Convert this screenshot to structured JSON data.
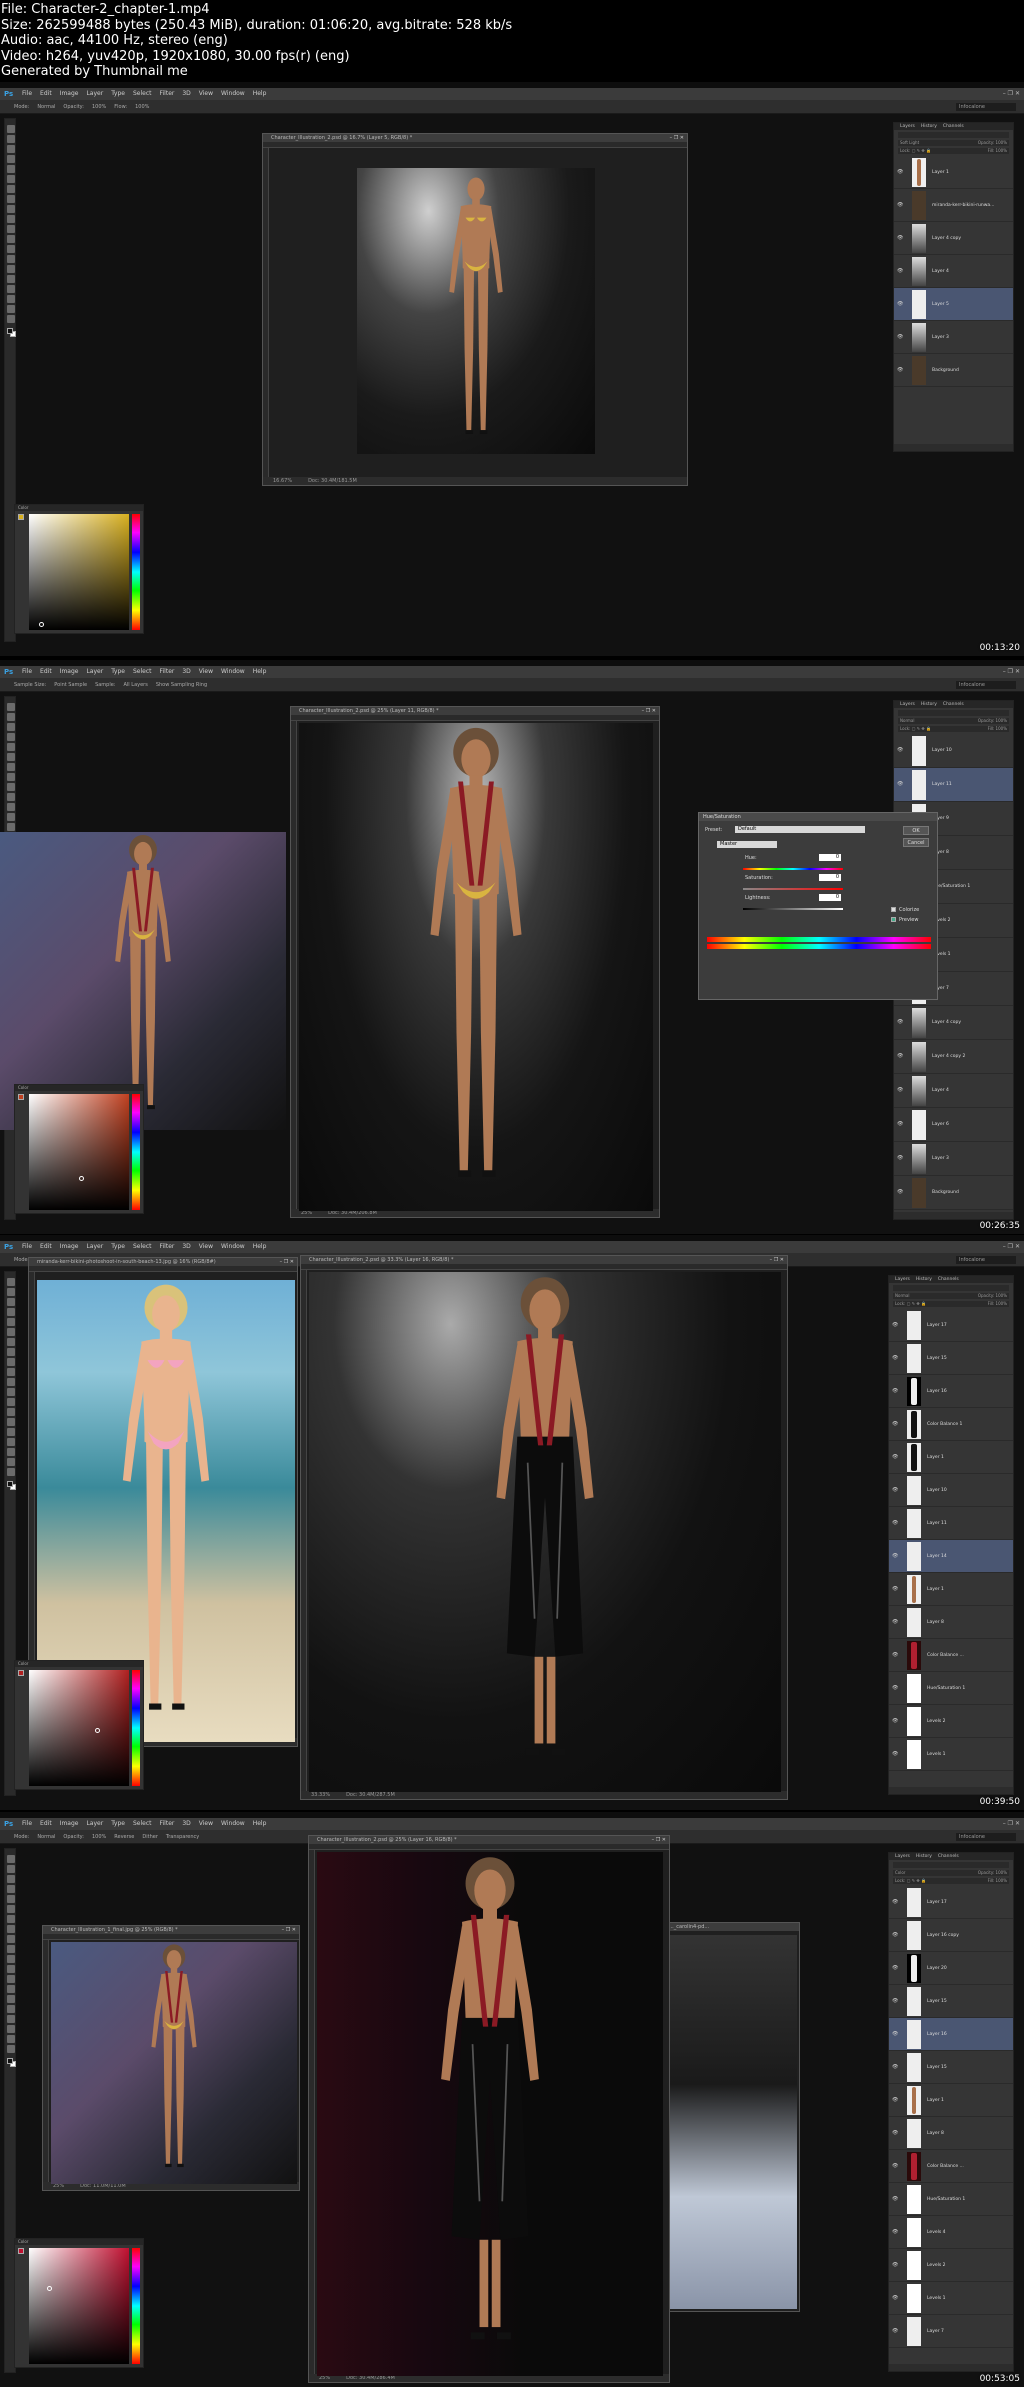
{
  "header": {
    "file_line": "File: Character-2_chapter-1.mp4",
    "size_line": "Size: 262599488 bytes (250.43 MiB), duration: 01:06:20, avg.bitrate: 528 kb/s",
    "audio_line": "Audio: aac, 44100 Hz, stereo (eng)",
    "video_line": "Video: h264, yuv420p, 1920x1080, 30.00 fps(r) (eng)",
    "generated_line": "Generated by Thumbnail me"
  },
  "menu": {
    "app_icon": "Ps",
    "items": [
      "File",
      "Edit",
      "Image",
      "Layer",
      "Type",
      "Select",
      "Filter",
      "3D",
      "View",
      "Window",
      "Help"
    ],
    "window_controls": "– ❐ ✕"
  },
  "workspace_label": "Infocalone",
  "frames": [
    {
      "timestamp": "00:13:20",
      "options_bar": [
        "Mode:",
        "Normal",
        "Opacity:",
        "100%",
        "Flow:",
        "100%"
      ],
      "doc_title": "Character_Illustration_2.psd @ 16.7% (Layer 5, RGB/8) *",
      "doc_status": [
        "16.67%",
        "Doc: 30.4M/181.5M"
      ],
      "panel_tabs": [
        "Layers",
        "History",
        "Channels"
      ],
      "blend": "Soft Light",
      "opacity": "Opacity: 100%",
      "fill": "Fill: 100%",
      "layers": [
        {
          "name": "Layer 1",
          "thumb": "fig",
          "selected": false
        },
        {
          "name": "miranda-kerr-bikini-runwa...",
          "thumb": "dark",
          "selected": false
        },
        {
          "name": "Layer 4 copy",
          "thumb": "grad",
          "selected": false
        },
        {
          "name": "Layer 4",
          "thumb": "grad",
          "selected": false
        },
        {
          "name": "Layer 5",
          "thumb": "light",
          "selected": true
        },
        {
          "name": "Layer 3",
          "thumb": "grad",
          "selected": false
        },
        {
          "name": "Background",
          "thumb": "dark",
          "selected": false
        }
      ]
    },
    {
      "timestamp": "00:26:35",
      "options_bar": [
        "Sample Size:",
        "Point Sample",
        "Sample:",
        "All Layers",
        "Show Sampling Ring"
      ],
      "doc_title": "Character_Illustration_2.psd @ 25% (Layer 11, RGB/8) *",
      "doc_status": [
        "25%",
        "Doc: 30.4M/206.8M"
      ],
      "panel_tabs": [
        "Layers",
        "History",
        "Channels"
      ],
      "blend": "Normal",
      "opacity": "Opacity: 100%",
      "fill": "Fill: 100%",
      "layers": [
        {
          "name": "Layer 10",
          "thumb": "light",
          "selected": false
        },
        {
          "name": "Layer 11",
          "thumb": "light",
          "selected": true
        },
        {
          "name": "Layer 9",
          "thumb": "light",
          "selected": false
        },
        {
          "name": "Layer 8",
          "thumb": "light",
          "selected": false
        },
        {
          "name": "Hue/Saturation 1",
          "thumb": "white",
          "selected": false
        },
        {
          "name": "Levels 2",
          "thumb": "white",
          "selected": false
        },
        {
          "name": "Levels 1",
          "thumb": "white",
          "selected": false
        },
        {
          "name": "Layer 7",
          "thumb": "light",
          "selected": false
        },
        {
          "name": "Layer 4 copy",
          "thumb": "grad",
          "selected": false
        },
        {
          "name": "Layer 4 copy 2",
          "thumb": "grad",
          "selected": false
        },
        {
          "name": "Layer 4",
          "thumb": "grad",
          "selected": false
        },
        {
          "name": "Layer 6",
          "thumb": "light",
          "selected": false
        },
        {
          "name": "Layer 3",
          "thumb": "grad",
          "selected": false
        },
        {
          "name": "Background",
          "thumb": "dark",
          "selected": false
        }
      ],
      "dialog": {
        "title": "Hue/Saturation",
        "preset_label": "Preset:",
        "preset_value": "Default",
        "channel": "Master",
        "hue_label": "Hue:",
        "hue_value": "0",
        "saturation_label": "Saturation:",
        "saturation_value": "0",
        "lightness_label": "Lightness:",
        "lightness_value": "0",
        "colorize_label": "Colorize",
        "preview_label": "Preview",
        "ok_label": "OK",
        "cancel_label": "Cancel"
      }
    },
    {
      "timestamp": "00:39:50",
      "options_bar": [
        "Mode:",
        "Normal",
        "Strength:",
        "50%",
        "Sample All Layers",
        "Finger Painting"
      ],
      "doc_title": "Character_Illustration_2.psd @ 33.3% (Layer 16, RGB/8) *",
      "doc_status": [
        "33.33%",
        "Doc: 30.4M/287.5M"
      ],
      "ref_title": "miranda-kerr-bikini-photoshoot-in-south-beach-13.jpg @ 16% (RGB/8#)",
      "panel_tabs": [
        "Layers",
        "History",
        "Channels"
      ],
      "blend": "Normal",
      "opacity": "Opacity: 100%",
      "fill": "Fill: 100%",
      "layers": [
        {
          "name": "Layer 17",
          "thumb": "light",
          "selected": false
        },
        {
          "name": "Layer 15",
          "thumb": "light",
          "selected": false
        },
        {
          "name": "Layer 16",
          "thumb": "black",
          "selected": false
        },
        {
          "name": "Color Balance 1",
          "thumb": "mask",
          "selected": false
        },
        {
          "name": "Layer 1",
          "thumb": "mask",
          "selected": false
        },
        {
          "name": "Layer 10",
          "thumb": "light",
          "selected": false
        },
        {
          "name": "Layer 11",
          "thumb": "light",
          "selected": false
        },
        {
          "name": "Layer 14",
          "thumb": "light",
          "selected": true
        },
        {
          "name": "Layer 1",
          "thumb": "fig",
          "selected": false
        },
        {
          "name": "Layer 8",
          "thumb": "light",
          "selected": false
        },
        {
          "name": "Color Balance ...",
          "thumb": "red",
          "selected": false
        },
        {
          "name": "Hue/Saturation 1",
          "thumb": "white",
          "selected": false
        },
        {
          "name": "Levels 2",
          "thumb": "white",
          "selected": false
        },
        {
          "name": "Levels 1",
          "thumb": "white",
          "selected": false
        }
      ]
    },
    {
      "timestamp": "00:53:05",
      "options_bar": [
        "Mode:",
        "Normal",
        "Opacity:",
        "100%",
        "Reverse",
        "Dither",
        "Transparency"
      ],
      "doc_title": "Character_Illustration_2.psd @ 25% (Layer 16, RGB/8) *",
      "doc_status": [
        "25%",
        "Doc: 30.4M/286.4M"
      ],
      "ref_title": "Character_Illustration_1_final.jpg @ 25% (RGB/8) *",
      "ref_status": [
        "25%",
        "Doc: 11.0M/11.0M"
      ],
      "panel_tabs": [
        "Layers",
        "History",
        "Channels"
      ],
      "blend": "Color",
      "opacity": "Opacity: 100%",
      "fill": "Fill: 100%",
      "layers": [
        {
          "name": "Layer 17",
          "thumb": "light",
          "selected": false
        },
        {
          "name": "Layer 16 copy",
          "thumb": "light",
          "selected": false
        },
        {
          "name": "Layer 20",
          "thumb": "black",
          "selected": false
        },
        {
          "name": "Layer 15",
          "thumb": "light",
          "selected": false
        },
        {
          "name": "Layer 16",
          "thumb": "light",
          "selected": true
        },
        {
          "name": "Layer 15",
          "thumb": "light",
          "selected": false
        },
        {
          "name": "Layer 1",
          "thumb": "fig",
          "selected": false
        },
        {
          "name": "Layer 8",
          "thumb": "light",
          "selected": false
        },
        {
          "name": "Color Balance ...",
          "thumb": "red",
          "selected": false
        },
        {
          "name": "Hue/Saturation 1",
          "thumb": "white",
          "selected": false
        },
        {
          "name": "Levels 4",
          "thumb": "white",
          "selected": false
        },
        {
          "name": "Levels 2",
          "thumb": "white",
          "selected": false
        },
        {
          "name": "Levels 1",
          "thumb": "white",
          "selected": false
        },
        {
          "name": "Layer 7",
          "thumb": "light",
          "selected": false
        }
      ]
    }
  ],
  "colors": {
    "ps_blue": "#3aa0e0",
    "selection": "#4a5672",
    "strap_red": "#8b1a24",
    "bikini_yellow": "#d9b440",
    "bikini_pink": "#f3a4c0",
    "color_field_1": "#d8b020",
    "color_field_2": "#c04020",
    "color_field_3": "#b02020",
    "color_field_4": "#c01030"
  },
  "icons": [
    "eye-icon",
    "move-tool-icon",
    "brush-tool-icon",
    "eyedropper-icon",
    "smudge-tool-icon",
    "gradient-tool-icon",
    "lock-icon"
  ]
}
